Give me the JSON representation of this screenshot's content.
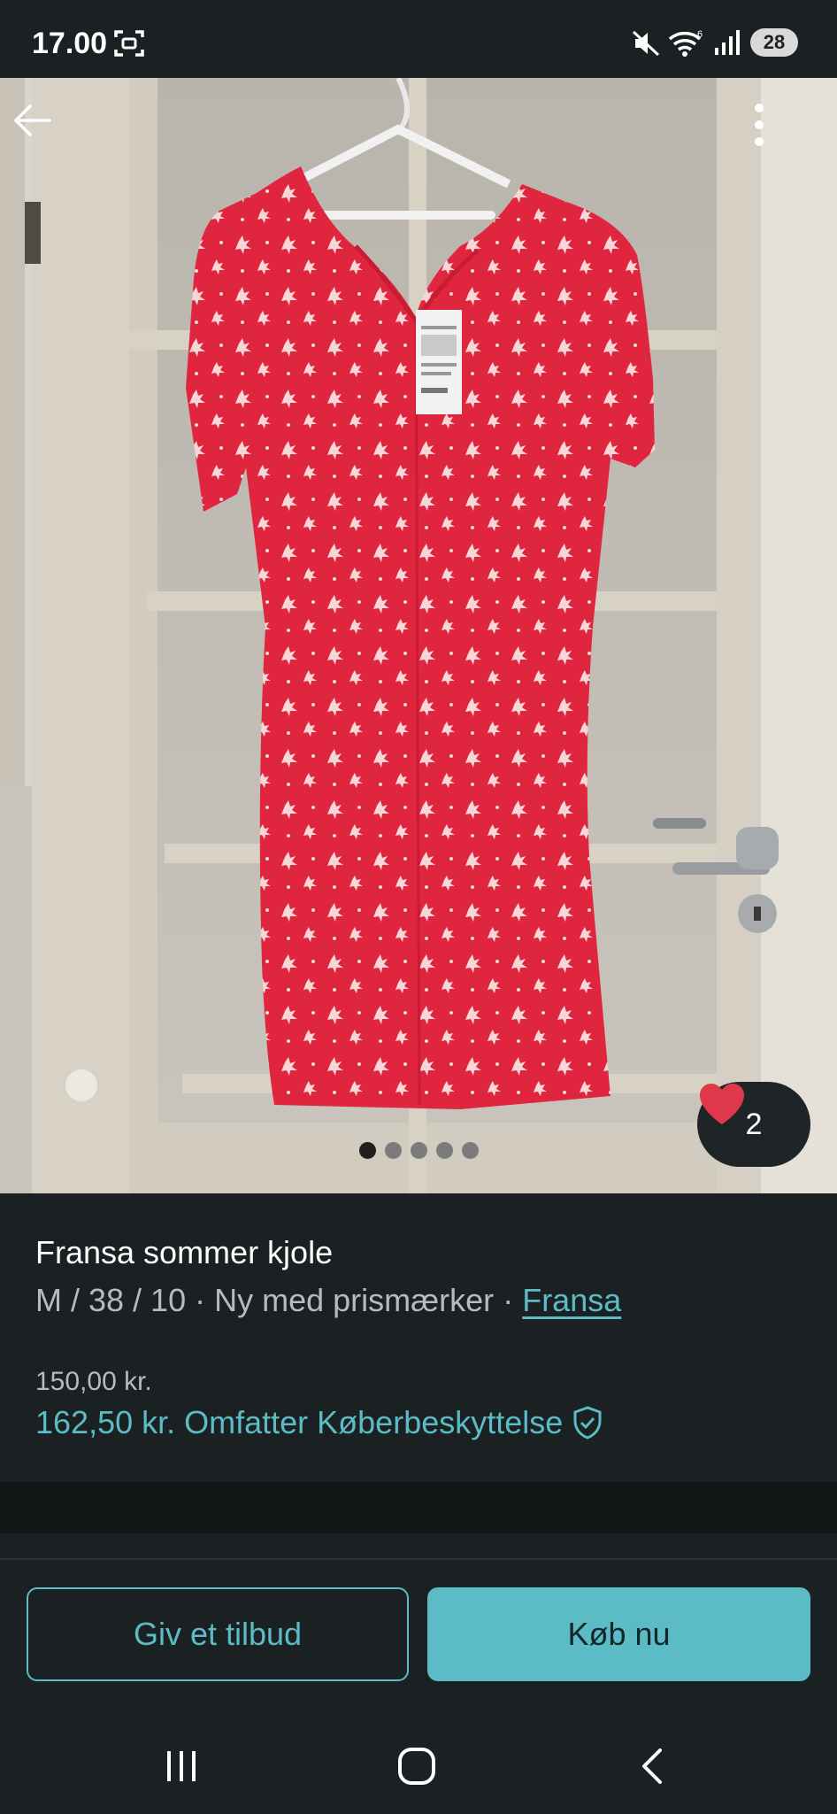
{
  "status_bar": {
    "time": "17.00",
    "battery": "28"
  },
  "listing": {
    "title": "Fransa sommer kjole",
    "size": "M / 38 / 10",
    "separator": "·",
    "condition": "Ny med prismærker",
    "brand": "Fransa",
    "price": "150,00 kr.",
    "total_price": "162,50 kr.",
    "protection_label": "Omfatter Køberbeskyttelse",
    "favorites_count": "2"
  },
  "carousel": {
    "photo_count": 5,
    "active_index": 0
  },
  "actions": {
    "offer_label": "Giv et tilbud",
    "buy_label": "Køb nu"
  },
  "colors": {
    "accent": "#5bbcc6",
    "background": "#1b2022",
    "dress": "#e0263f",
    "heart": "#e0384b"
  },
  "icons": {
    "status": [
      "screenshot-icon",
      "mute-icon",
      "wifi-icon",
      "signal-icon",
      "battery-icon"
    ],
    "photo": [
      "back-arrow-icon",
      "more-vertical-icon",
      "heart-icon"
    ],
    "protection": "shield-check-icon",
    "nav": [
      "recents-icon",
      "home-icon",
      "back-icon"
    ]
  }
}
